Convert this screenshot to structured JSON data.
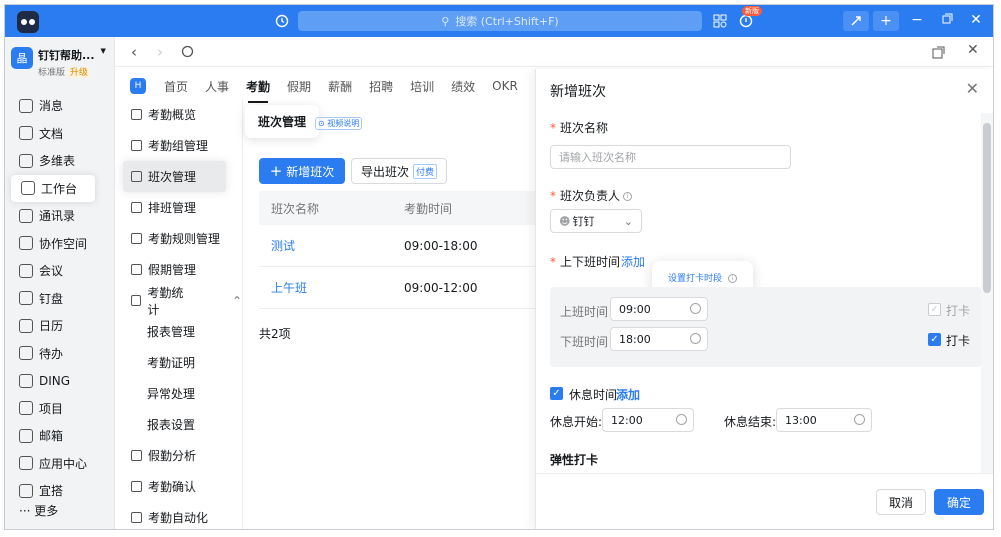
{
  "titlebar": {
    "search_placeholder": "搜索 (Ctrl+Shift+F)",
    "badge": "新版"
  },
  "org": {
    "name": "钉钉帮助...",
    "edition": "标准版",
    "upgrade": "升级",
    "logo_text": "晶"
  },
  "left_nav": {
    "items": [
      {
        "label": "消息",
        "icon": "message-icon"
      },
      {
        "label": "文档",
        "icon": "doc-icon"
      },
      {
        "label": "多维表",
        "icon": "table-icon"
      },
      {
        "label": "工作台",
        "icon": "grid-icon"
      },
      {
        "label": "通讯录",
        "icon": "contacts-icon"
      },
      {
        "label": "协作空间",
        "icon": "space-icon"
      },
      {
        "label": "会议",
        "icon": "meeting-icon"
      },
      {
        "label": "钉盘",
        "icon": "cloud-icon"
      },
      {
        "label": "日历",
        "icon": "calendar-icon"
      },
      {
        "label": "待办",
        "icon": "todo-icon"
      },
      {
        "label": "DING",
        "icon": "ding-icon"
      },
      {
        "label": "项目",
        "icon": "project-icon"
      },
      {
        "label": "邮箱",
        "icon": "mail-icon"
      },
      {
        "label": "应用中心",
        "icon": "apps-icon"
      },
      {
        "label": "宜搭",
        "icon": "yida-icon"
      }
    ],
    "more": "··· 更多"
  },
  "top_tabs": [
    "首页",
    "人事",
    "考勤",
    "假期",
    "薪酬",
    "招聘",
    "培训",
    "绩效",
    "OKR"
  ],
  "sub_nav": [
    {
      "label": "考勤概览",
      "type": "item"
    },
    {
      "label": "考勤组管理",
      "type": "item"
    },
    {
      "label": "班次管理",
      "type": "item",
      "active": true
    },
    {
      "label": "排班管理",
      "type": "item"
    },
    {
      "label": "考勤规则管理",
      "type": "item"
    },
    {
      "label": "假期管理",
      "type": "item"
    },
    {
      "label": "考勤统计",
      "type": "group"
    },
    {
      "label": "报表管理",
      "type": "child"
    },
    {
      "label": "考勤证明",
      "type": "child"
    },
    {
      "label": "异常处理",
      "type": "child"
    },
    {
      "label": "报表设置",
      "type": "child"
    },
    {
      "label": "假勤分析",
      "type": "item"
    },
    {
      "label": "考勤确认",
      "type": "item"
    },
    {
      "label": "考勤自动化",
      "type": "item"
    }
  ],
  "content": {
    "page_title": "班次管理",
    "video_tag": "视频说明",
    "add_button": "新增班次",
    "export_button": "导出班次",
    "paid_tag": "付费",
    "columns": [
      "班次名称",
      "考勤时间"
    ],
    "rows": [
      {
        "name": "测试",
        "time": "09:00-18:00"
      },
      {
        "name": "上午班",
        "time": "09:00-12:00"
      }
    ],
    "total": "共2项"
  },
  "drawer": {
    "title": "新增班次",
    "name_label": "班次名称",
    "name_placeholder": "请输入班次名称",
    "owner_label": "班次负责人",
    "owner_value": "钉钉",
    "time_label": "上下班时间",
    "add_link": "添加",
    "popover": "设置打卡时段",
    "on_label": "上班时间",
    "on_value": "09:00",
    "off_label": "下班时间",
    "off_value": "18:00",
    "punch_label_1": "打卡",
    "punch_label_2": "打卡",
    "rest_label": "休息时间",
    "rest_add": "添加",
    "rest_start_label": "休息开始:",
    "rest_start_value": "12:00",
    "rest_end_label": "休息结束:",
    "rest_end_value": "13:00",
    "flex_label": "弹性打卡",
    "cancel": "取消",
    "confirm": "确定"
  },
  "colors": {
    "accent": "#2a7cf0",
    "titlebar": "#2a7cf0"
  }
}
